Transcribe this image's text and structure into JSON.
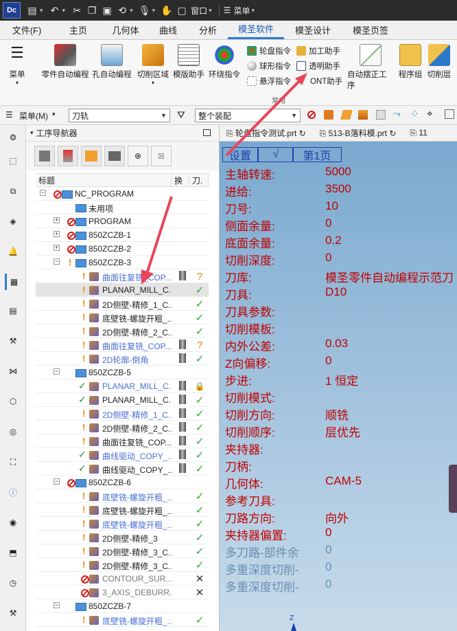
{
  "qat": {
    "logo": "Dc",
    "window_menu": "窗口",
    "menu": "菜单"
  },
  "tabs": [
    "文件(F)",
    "主页",
    "几何体",
    "曲线",
    "分析",
    "模圣软件",
    "模圣设计",
    "模圣页签"
  ],
  "active_tab": "模圣软件",
  "ribbon": {
    "menu_label": "菜单",
    "buttons": [
      "零件自动编程",
      "孔自动编程",
      "切削区域",
      "模版助手",
      "环绕指令",
      "自动摆正工序",
      "程序组",
      "切削层"
    ],
    "small_col1": [
      "轮盘指令",
      "球形指令",
      "悬浮指令"
    ],
    "small_col2": [
      "加工助手",
      "透明助手",
      "ONT助手"
    ],
    "group_label": "常用"
  },
  "toolbar2": {
    "menu_label": "菜单(M)",
    "filter_value": "刀轨",
    "assembly_value": "整个装配"
  },
  "navigator": {
    "title": "工序导航器",
    "col_name": "标题",
    "col_change": "换",
    "col_tool": "刀.",
    "rows": [
      {
        "name": "NC_PROGRAM",
        "indent": 0,
        "exp": "−",
        "pre": "noent",
        "icon": "fold",
        "nm": false,
        "status": ""
      },
      {
        "name": "未用项",
        "indent": 1,
        "exp": "",
        "pre": "",
        "icon": "fold",
        "nm": false,
        "status": ""
      },
      {
        "name": "PROGRAM",
        "indent": 1,
        "exp": "+",
        "pre": "noent",
        "icon": "fold",
        "nm": false,
        "status": ""
      },
      {
        "name": "850ZCZB-1",
        "indent": 1,
        "exp": "+",
        "pre": "noent",
        "icon": "fold",
        "nm": false,
        "status": ""
      },
      {
        "name": "850ZCZB-2",
        "indent": 1,
        "exp": "+",
        "pre": "noent",
        "icon": "fold",
        "nm": false,
        "status": ""
      },
      {
        "name": "850ZCZB-3",
        "indent": 1,
        "exp": "−",
        "pre": "warn",
        "icon": "fold",
        "nm": false,
        "status": ""
      },
      {
        "name": "曲面往复铣_COP...",
        "indent": 2,
        "exp": "",
        "pre": "warn",
        "icon": "op",
        "style": "blue",
        "nm": true,
        "status": "?"
      },
      {
        "name": "PLANAR_MILL_C...",
        "indent": 2,
        "exp": "",
        "pre": "warn",
        "icon": "op",
        "nm": false,
        "status": "✓",
        "sel": true
      },
      {
        "name": "2D侧壁-精修_1_C...",
        "indent": 2,
        "exp": "",
        "pre": "warn",
        "icon": "op",
        "nm": false,
        "status": "✓"
      },
      {
        "name": "底壁铣-螺旋开粗_...",
        "indent": 2,
        "exp": "",
        "pre": "warn",
        "icon": "op",
        "nm": false,
        "status": "✓"
      },
      {
        "name": "2D侧壁-精修_2_C...",
        "indent": 2,
        "exp": "",
        "pre": "warn",
        "icon": "op",
        "nm": false,
        "status": "✓"
      },
      {
        "name": "曲面往复铣_COP...",
        "indent": 2,
        "exp": "",
        "pre": "warn",
        "icon": "op",
        "style": "blue",
        "nm": true,
        "status": "?"
      },
      {
        "name": "2D轮廓-倒角",
        "indent": 2,
        "exp": "",
        "pre": "warn",
        "icon": "op",
        "style": "blue",
        "nm": true,
        "status": "✓"
      },
      {
        "name": "850ZCZB-5",
        "indent": 1,
        "exp": "−",
        "pre": "",
        "icon": "fold",
        "nm": false,
        "status": ""
      },
      {
        "name": "PLANAR_MILL_C...",
        "indent": 2,
        "exp": "",
        "pre": "ckg",
        "icon": "op",
        "style": "blue",
        "nm": true,
        "status": "🔒"
      },
      {
        "name": "PLANAR_MILL_C...",
        "indent": 2,
        "exp": "",
        "pre": "ckg",
        "icon": "op",
        "nm": true,
        "status": "✓"
      },
      {
        "name": "2D侧壁-精修_1_C...",
        "indent": 2,
        "exp": "",
        "pre": "warn",
        "icon": "op",
        "style": "blue",
        "nm": true,
        "status": "✓"
      },
      {
        "name": "2D侧壁-精修_2_C...",
        "indent": 2,
        "exp": "",
        "pre": "warn",
        "icon": "op",
        "nm": true,
        "status": "✓"
      },
      {
        "name": "曲面往复铣_COP...",
        "indent": 2,
        "exp": "",
        "pre": "warn",
        "icon": "op",
        "nm": true,
        "status": "✓"
      },
      {
        "name": "曲线驱动_COPY_...",
        "indent": 2,
        "exp": "",
        "pre": "ckg",
        "icon": "op",
        "style": "blue",
        "nm": true,
        "status": "✓"
      },
      {
        "name": "曲线驱动_COPY_...",
        "indent": 2,
        "exp": "",
        "pre": "ckg",
        "icon": "op",
        "nm": true,
        "status": "✓"
      },
      {
        "name": "850ZCZB-6",
        "indent": 1,
        "exp": "−",
        "pre": "noent",
        "icon": "fold",
        "nm": false,
        "status": ""
      },
      {
        "name": "底壁铣-螺旋开粗_...",
        "indent": 2,
        "exp": "",
        "pre": "warn",
        "icon": "op",
        "style": "blue",
        "nm": false,
        "status": "✓"
      },
      {
        "name": "底壁铣-螺旋开粗_...",
        "indent": 2,
        "exp": "",
        "pre": "warn",
        "icon": "op",
        "nm": false,
        "status": "✓"
      },
      {
        "name": "底壁铣-螺旋开粗_...",
        "indent": 2,
        "exp": "",
        "pre": "warn",
        "icon": "op",
        "style": "blue",
        "nm": false,
        "status": "✓"
      },
      {
        "name": "2D侧壁-精修_3",
        "indent": 2,
        "exp": "",
        "pre": "warn",
        "icon": "op",
        "nm": false,
        "status": "✓"
      },
      {
        "name": "2D侧壁-精修_3_C...",
        "indent": 2,
        "exp": "",
        "pre": "warn",
        "icon": "op",
        "nm": false,
        "status": "✓"
      },
      {
        "name": "2D侧壁-精修_3_C...",
        "indent": 2,
        "exp": "",
        "pre": "warn",
        "icon": "op",
        "nm": false,
        "status": "✓"
      },
      {
        "name": "CONTOUR_SUR...",
        "indent": 2,
        "exp": "",
        "pre": "noent",
        "icon": "op",
        "style": "grey",
        "nm": false,
        "status": "✕"
      },
      {
        "name": "3_AXIS_DEBURR...",
        "indent": 2,
        "exp": "",
        "pre": "noent",
        "icon": "op",
        "style": "grey",
        "nm": false,
        "status": "✕"
      },
      {
        "name": "850ZCZB-7",
        "indent": 1,
        "exp": "−",
        "pre": "",
        "icon": "fold",
        "nm": false,
        "status": ""
      },
      {
        "name": "底壁铣-螺旋开粗_...",
        "indent": 2,
        "exp": "",
        "pre": "warn",
        "icon": "op",
        "style": "blue",
        "nm": false,
        "status": "✓"
      }
    ]
  },
  "file_tabs": [
    "轮盘指令测试.prt",
    "513-B落料模.prt",
    "11"
  ],
  "params_header": {
    "settings": "设置",
    "check": "√",
    "page": "第1页"
  },
  "params": [
    {
      "label": "主轴转速:",
      "value": "5000"
    },
    {
      "label": "进给:",
      "value": "3500"
    },
    {
      "label": "刀号:",
      "value": "10"
    },
    {
      "label": "侧面余量:",
      "value": "0"
    },
    {
      "label": "底面余量:",
      "value": "0.2"
    },
    {
      "label": "切削深度:",
      "value": "0"
    },
    {
      "label": "刀库:",
      "value": "模圣零件自动编程示范刀"
    },
    {
      "label": "刀具:",
      "value": "D10"
    },
    {
      "label": "刀具参数:",
      "value": ""
    },
    {
      "label": "切削模板:",
      "value": ""
    },
    {
      "label": "内外公差:",
      "value": "0.03"
    },
    {
      "label": "Z向偏移:",
      "value": "0"
    },
    {
      "label": "步进:",
      "value": "1  恒定"
    },
    {
      "label": "切削模式:",
      "value": ""
    },
    {
      "label": "切削方向:",
      "value": "顺铣"
    },
    {
      "label": "切削顺序:",
      "value": "层优先"
    },
    {
      "label": "夹持器:",
      "value": ""
    },
    {
      "label": "刀柄:",
      "value": ""
    },
    {
      "label": "几何体:",
      "value": "CAM-5"
    },
    {
      "label": "参考刀具:",
      "value": ""
    },
    {
      "label": "刀路方向:",
      "value": "向外"
    },
    {
      "label": "夹持器偏置:",
      "value": "0"
    },
    {
      "label": "多刀路-部件余",
      "value": "0",
      "dim": true
    },
    {
      "label": "多重深度切削-",
      "value": "0",
      "dim": true
    },
    {
      "label": "多重深度切削-",
      "value": "0",
      "dim": true
    }
  ],
  "axis_label": "Z",
  "colors": {
    "accent": "#2a7bd4",
    "param_red": "#c00000",
    "header_blue": "#1c3fae",
    "arrow": "#e8465a"
  }
}
